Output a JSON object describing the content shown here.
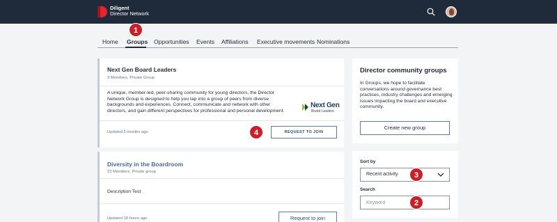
{
  "brand": {
    "line1": "Diligent",
    "line2": "Director Network",
    "color": "#e0262f"
  },
  "nav": {
    "items": [
      {
        "label": "Home"
      },
      {
        "label": "Groups"
      },
      {
        "label": "Opportunities"
      },
      {
        "label": "Events"
      },
      {
        "label": "Affiliations"
      },
      {
        "label": "Executive movements"
      },
      {
        "label": "Nominations"
      }
    ],
    "active": "Groups"
  },
  "callouts": [
    "1",
    "2",
    "3",
    "4"
  ],
  "groups": [
    {
      "title": "Next Gen Board Leaders",
      "meta": "3 Members, Private Group",
      "description": "A unique, member-led, peer-sharing community for young directors, the Director Network Group is designed to help you tap into a group of peers from diverse backgrounds and experiences. Connect, communicate and network with other directors, and gain different perspectives for professional and personal development.",
      "logo_line1": "Next Gen",
      "logo_line2": "Board Leaders",
      "updated": "Updated 5 months ago",
      "button": "REQUEST TO JOIN"
    },
    {
      "title": "Diversity in the Boardroom",
      "meta": "23 Members, Private group",
      "description": "Description Test",
      "updated": "Updated 18 hours ago",
      "button": "Request to join"
    }
  ],
  "sidebar": {
    "title": "Director community groups",
    "description": "In Groups, we hope to facilitate conversations around governance best practices, industry challenges and emerging issues impacting the board and executive community.",
    "create_button": "Create new group",
    "sort_label": "Sort by",
    "sort_value": "Recent activity",
    "search_label": "Search",
    "search_placeholder": "Keyword"
  },
  "colors": {
    "topbar": "#1f2a3a",
    "callout": "#c8202a",
    "button_border": "#5a7aa8"
  },
  "icons": [
    "search-icon",
    "chevron-down-icon",
    "user-avatar",
    "next-gen-logo-arrow-icon"
  ]
}
